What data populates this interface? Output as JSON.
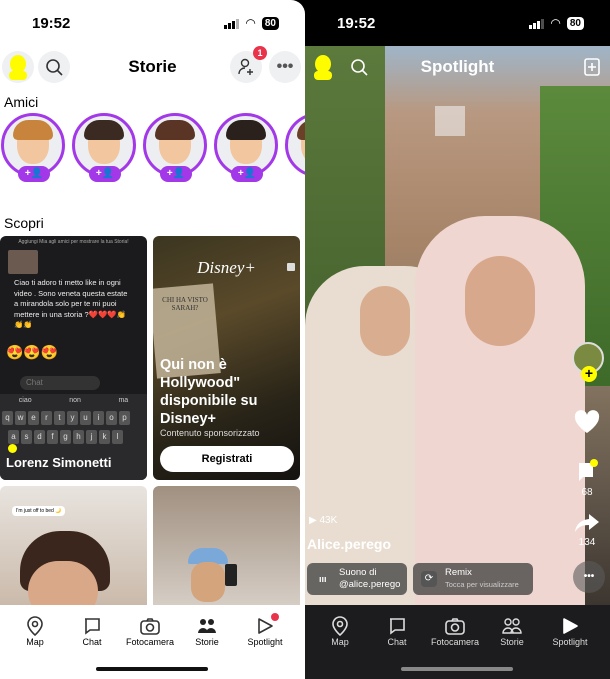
{
  "left": {
    "status": {
      "time": "19:52",
      "battery": "80"
    },
    "header": {
      "title": "Storie",
      "notification_count": "1"
    },
    "friends_label": "Amici",
    "friends": [
      {
        "hair": "#c8843c"
      },
      {
        "hair": "#3a2a22"
      },
      {
        "hair": "#5a3424"
      },
      {
        "hair": "#2a201c"
      },
      {
        "hair": "#6a4028"
      }
    ],
    "add_label": "+👤",
    "discover_label": "Scopri",
    "card1": {
      "banner": "Aggiungi Mia agli amici per mostrare la tua Storia!",
      "message": "Ciao ti adoro ti metto like in ogni video . Sono veneta questa estate a mirandola solo per te mi puoi mettere in una storia ?❤️❤️❤️👏👏👏",
      "emojis": "😍😍😍",
      "chat_placeholder": "Chat",
      "suggestions": [
        "ciao",
        "non",
        "ma"
      ],
      "keys_row1": [
        "q",
        "w",
        "e",
        "r",
        "t",
        "y",
        "u",
        "i",
        "o",
        "p"
      ],
      "keys_row2": [
        "a",
        "s",
        "d",
        "f",
        "g",
        "h",
        "j",
        "k",
        "l"
      ],
      "name": "Lorenz Simonetti"
    },
    "card2": {
      "brand": "Disney+",
      "poster_text": "CHI HA VISTO SARAH?",
      "headline": "Qui non è Hollywood\" disponibile su Disney+",
      "sponsored": "Contenuto sponsorizzato",
      "cta": "Registrati"
    },
    "card3": {
      "caption": "I'm just off to bed 🌙"
    },
    "tabs": [
      {
        "label": "Map",
        "icon": "map-pin-icon"
      },
      {
        "label": "Chat",
        "icon": "chat-icon"
      },
      {
        "label": "Fotocamera",
        "icon": "camera-icon"
      },
      {
        "label": "Storie",
        "icon": "stories-icon",
        "active": true
      },
      {
        "label": "Spotlight",
        "icon": "spotlight-icon",
        "dot": true
      }
    ]
  },
  "right": {
    "status": {
      "time": "19:52",
      "battery": "80"
    },
    "header": {
      "title": "Spotlight"
    },
    "views": "▶ 43K",
    "username": "Alice.perego",
    "comments": "68",
    "shares": "134",
    "sound": {
      "line1": "Suono di",
      "line2": "@alice.perego"
    },
    "remix": {
      "title": "Remix",
      "subtitle": "Tocca per visualizzare"
    },
    "tabs": [
      {
        "label": "Map"
      },
      {
        "label": "Chat"
      },
      {
        "label": "Fotocamera"
      },
      {
        "label": "Storie"
      },
      {
        "label": "Spotlight",
        "active": true
      }
    ]
  },
  "colors": {
    "accent_purple": "#a238e8",
    "snap_yellow": "#fffc00",
    "badge_red": "#e8334b"
  }
}
